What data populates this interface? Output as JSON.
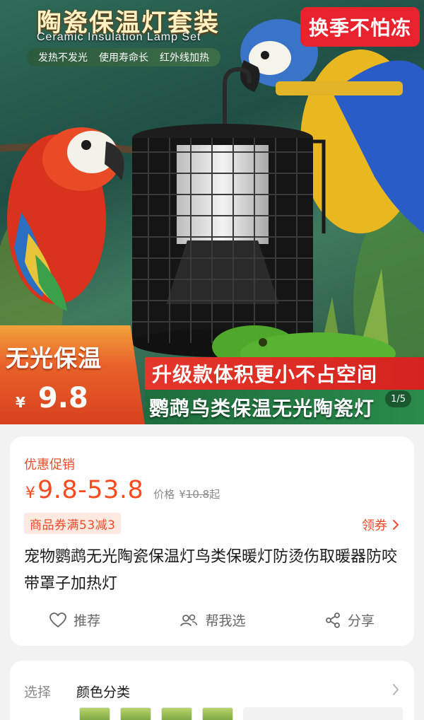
{
  "hero": {
    "title_cn": "陶瓷保温灯套装",
    "title_en": "Ceramic Insulation Lamp Set",
    "features": [
      "发热不发光",
      "使用寿命长",
      "红外线加热"
    ],
    "corner_tag": "换季不怕冻",
    "panel_title": "无光保温",
    "panel_currency": "¥",
    "panel_price": "9.8",
    "banner_red": "升级款体积更小不占空间",
    "banner_green": "鹦鹉鸟类保温无光陶瓷灯",
    "pager": "1/5"
  },
  "info": {
    "promo_label": "优惠促销",
    "currency": "¥",
    "price_range": "9.8-53.8",
    "original_label": "价格",
    "original_currency": "¥",
    "original_price": "10.8",
    "original_suffix": "起",
    "coupon_text": "商品券满53减3",
    "get_coupon": "领券",
    "product_title": "宠物鹦鹉无光陶瓷保温灯鸟类保暖灯防烫伤取暖器防咬带罩子加热灯",
    "actions": {
      "recommend": "推荐",
      "help_choose": "帮我选",
      "share": "分享"
    }
  },
  "sku": {
    "label": "选择",
    "value": "颜色分类"
  },
  "colors": {
    "accent": "#ff4a1f",
    "coupon_bg": "#ffe9e0",
    "corner_tag": "#e8232d",
    "banner_green": "#1e6d3c"
  }
}
